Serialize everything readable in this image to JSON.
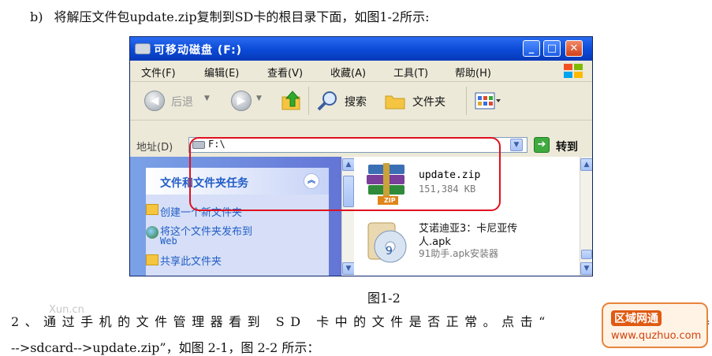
{
  "step_b": {
    "tag": "b)",
    "text": "将解压文件包update.zip复制到SD卡的根目录下面，如图1-2所示:"
  },
  "window": {
    "title": "可移动磁盘 (F:)",
    "title_icon": "drive-icon",
    "controls": {
      "minimize": "_",
      "maximize": "□",
      "close": "✕"
    },
    "menu": [
      "文件(F)",
      "编辑(E)",
      "查看(V)",
      "收藏(A)",
      "工具(T)",
      "帮助(H)"
    ],
    "toolbar": {
      "back": "后退",
      "search": "搜索",
      "folders": "文件夹"
    },
    "address": {
      "label": "地址(D)",
      "value": "F:\\",
      "go": "转到"
    },
    "tasks": {
      "header": "文件和文件夹任务",
      "items": [
        "创建一个新文件夹",
        "将这个文件夹发布到",
        "Web",
        "共享此文件夹"
      ]
    },
    "files": [
      {
        "name": "update.zip",
        "size": "151,384 KB",
        "badge": "ZIP"
      },
      {
        "name_line1": "艾诺迪亚3：卡尼亚传",
        "name_line2": "人.apk",
        "desc": "91助手.apk安装器"
      }
    ]
  },
  "caption": "图1-2",
  "para1": "2、通过手机的文件管理器看到 SD 卡中的文件是否正常。点击“",
  "para1_end": "器",
  "para2": "-->sdcard-->update.zip”，如图 2-1，图 2-2 所示：",
  "watermark": "Xun.cn",
  "stamp": {
    "line1": "区域网通",
    "line2": "www.quzhuo.com"
  },
  "colors": {
    "highlight": "#e0101e",
    "title_blue": "#0a4ad6",
    "task_blue": "#215dc6"
  }
}
